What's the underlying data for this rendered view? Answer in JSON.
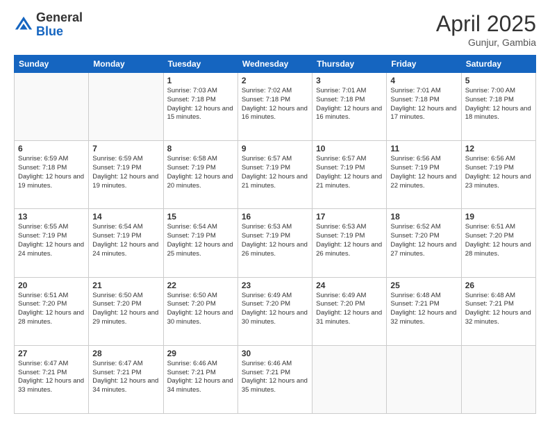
{
  "header": {
    "logo_general": "General",
    "logo_blue": "Blue",
    "title": "April 2025",
    "location": "Gunjur, Gambia"
  },
  "calendar": {
    "days_of_week": [
      "Sunday",
      "Monday",
      "Tuesday",
      "Wednesday",
      "Thursday",
      "Friday",
      "Saturday"
    ],
    "weeks": [
      [
        {
          "day": "",
          "info": ""
        },
        {
          "day": "",
          "info": ""
        },
        {
          "day": "1",
          "info": "Sunrise: 7:03 AM\nSunset: 7:18 PM\nDaylight: 12 hours and 15 minutes."
        },
        {
          "day": "2",
          "info": "Sunrise: 7:02 AM\nSunset: 7:18 PM\nDaylight: 12 hours and 16 minutes."
        },
        {
          "day": "3",
          "info": "Sunrise: 7:01 AM\nSunset: 7:18 PM\nDaylight: 12 hours and 16 minutes."
        },
        {
          "day": "4",
          "info": "Sunrise: 7:01 AM\nSunset: 7:18 PM\nDaylight: 12 hours and 17 minutes."
        },
        {
          "day": "5",
          "info": "Sunrise: 7:00 AM\nSunset: 7:18 PM\nDaylight: 12 hours and 18 minutes."
        }
      ],
      [
        {
          "day": "6",
          "info": "Sunrise: 6:59 AM\nSunset: 7:18 PM\nDaylight: 12 hours and 19 minutes."
        },
        {
          "day": "7",
          "info": "Sunrise: 6:59 AM\nSunset: 7:19 PM\nDaylight: 12 hours and 19 minutes."
        },
        {
          "day": "8",
          "info": "Sunrise: 6:58 AM\nSunset: 7:19 PM\nDaylight: 12 hours and 20 minutes."
        },
        {
          "day": "9",
          "info": "Sunrise: 6:57 AM\nSunset: 7:19 PM\nDaylight: 12 hours and 21 minutes."
        },
        {
          "day": "10",
          "info": "Sunrise: 6:57 AM\nSunset: 7:19 PM\nDaylight: 12 hours and 21 minutes."
        },
        {
          "day": "11",
          "info": "Sunrise: 6:56 AM\nSunset: 7:19 PM\nDaylight: 12 hours and 22 minutes."
        },
        {
          "day": "12",
          "info": "Sunrise: 6:56 AM\nSunset: 7:19 PM\nDaylight: 12 hours and 23 minutes."
        }
      ],
      [
        {
          "day": "13",
          "info": "Sunrise: 6:55 AM\nSunset: 7:19 PM\nDaylight: 12 hours and 24 minutes."
        },
        {
          "day": "14",
          "info": "Sunrise: 6:54 AM\nSunset: 7:19 PM\nDaylight: 12 hours and 24 minutes."
        },
        {
          "day": "15",
          "info": "Sunrise: 6:54 AM\nSunset: 7:19 PM\nDaylight: 12 hours and 25 minutes."
        },
        {
          "day": "16",
          "info": "Sunrise: 6:53 AM\nSunset: 7:19 PM\nDaylight: 12 hours and 26 minutes."
        },
        {
          "day": "17",
          "info": "Sunrise: 6:53 AM\nSunset: 7:19 PM\nDaylight: 12 hours and 26 minutes."
        },
        {
          "day": "18",
          "info": "Sunrise: 6:52 AM\nSunset: 7:20 PM\nDaylight: 12 hours and 27 minutes."
        },
        {
          "day": "19",
          "info": "Sunrise: 6:51 AM\nSunset: 7:20 PM\nDaylight: 12 hours and 28 minutes."
        }
      ],
      [
        {
          "day": "20",
          "info": "Sunrise: 6:51 AM\nSunset: 7:20 PM\nDaylight: 12 hours and 28 minutes."
        },
        {
          "day": "21",
          "info": "Sunrise: 6:50 AM\nSunset: 7:20 PM\nDaylight: 12 hours and 29 minutes."
        },
        {
          "day": "22",
          "info": "Sunrise: 6:50 AM\nSunset: 7:20 PM\nDaylight: 12 hours and 30 minutes."
        },
        {
          "day": "23",
          "info": "Sunrise: 6:49 AM\nSunset: 7:20 PM\nDaylight: 12 hours and 30 minutes."
        },
        {
          "day": "24",
          "info": "Sunrise: 6:49 AM\nSunset: 7:20 PM\nDaylight: 12 hours and 31 minutes."
        },
        {
          "day": "25",
          "info": "Sunrise: 6:48 AM\nSunset: 7:21 PM\nDaylight: 12 hours and 32 minutes."
        },
        {
          "day": "26",
          "info": "Sunrise: 6:48 AM\nSunset: 7:21 PM\nDaylight: 12 hours and 32 minutes."
        }
      ],
      [
        {
          "day": "27",
          "info": "Sunrise: 6:47 AM\nSunset: 7:21 PM\nDaylight: 12 hours and 33 minutes."
        },
        {
          "day": "28",
          "info": "Sunrise: 6:47 AM\nSunset: 7:21 PM\nDaylight: 12 hours and 34 minutes."
        },
        {
          "day": "29",
          "info": "Sunrise: 6:46 AM\nSunset: 7:21 PM\nDaylight: 12 hours and 34 minutes."
        },
        {
          "day": "30",
          "info": "Sunrise: 6:46 AM\nSunset: 7:21 PM\nDaylight: 12 hours and 35 minutes."
        },
        {
          "day": "",
          "info": ""
        },
        {
          "day": "",
          "info": ""
        },
        {
          "day": "",
          "info": ""
        }
      ]
    ]
  }
}
